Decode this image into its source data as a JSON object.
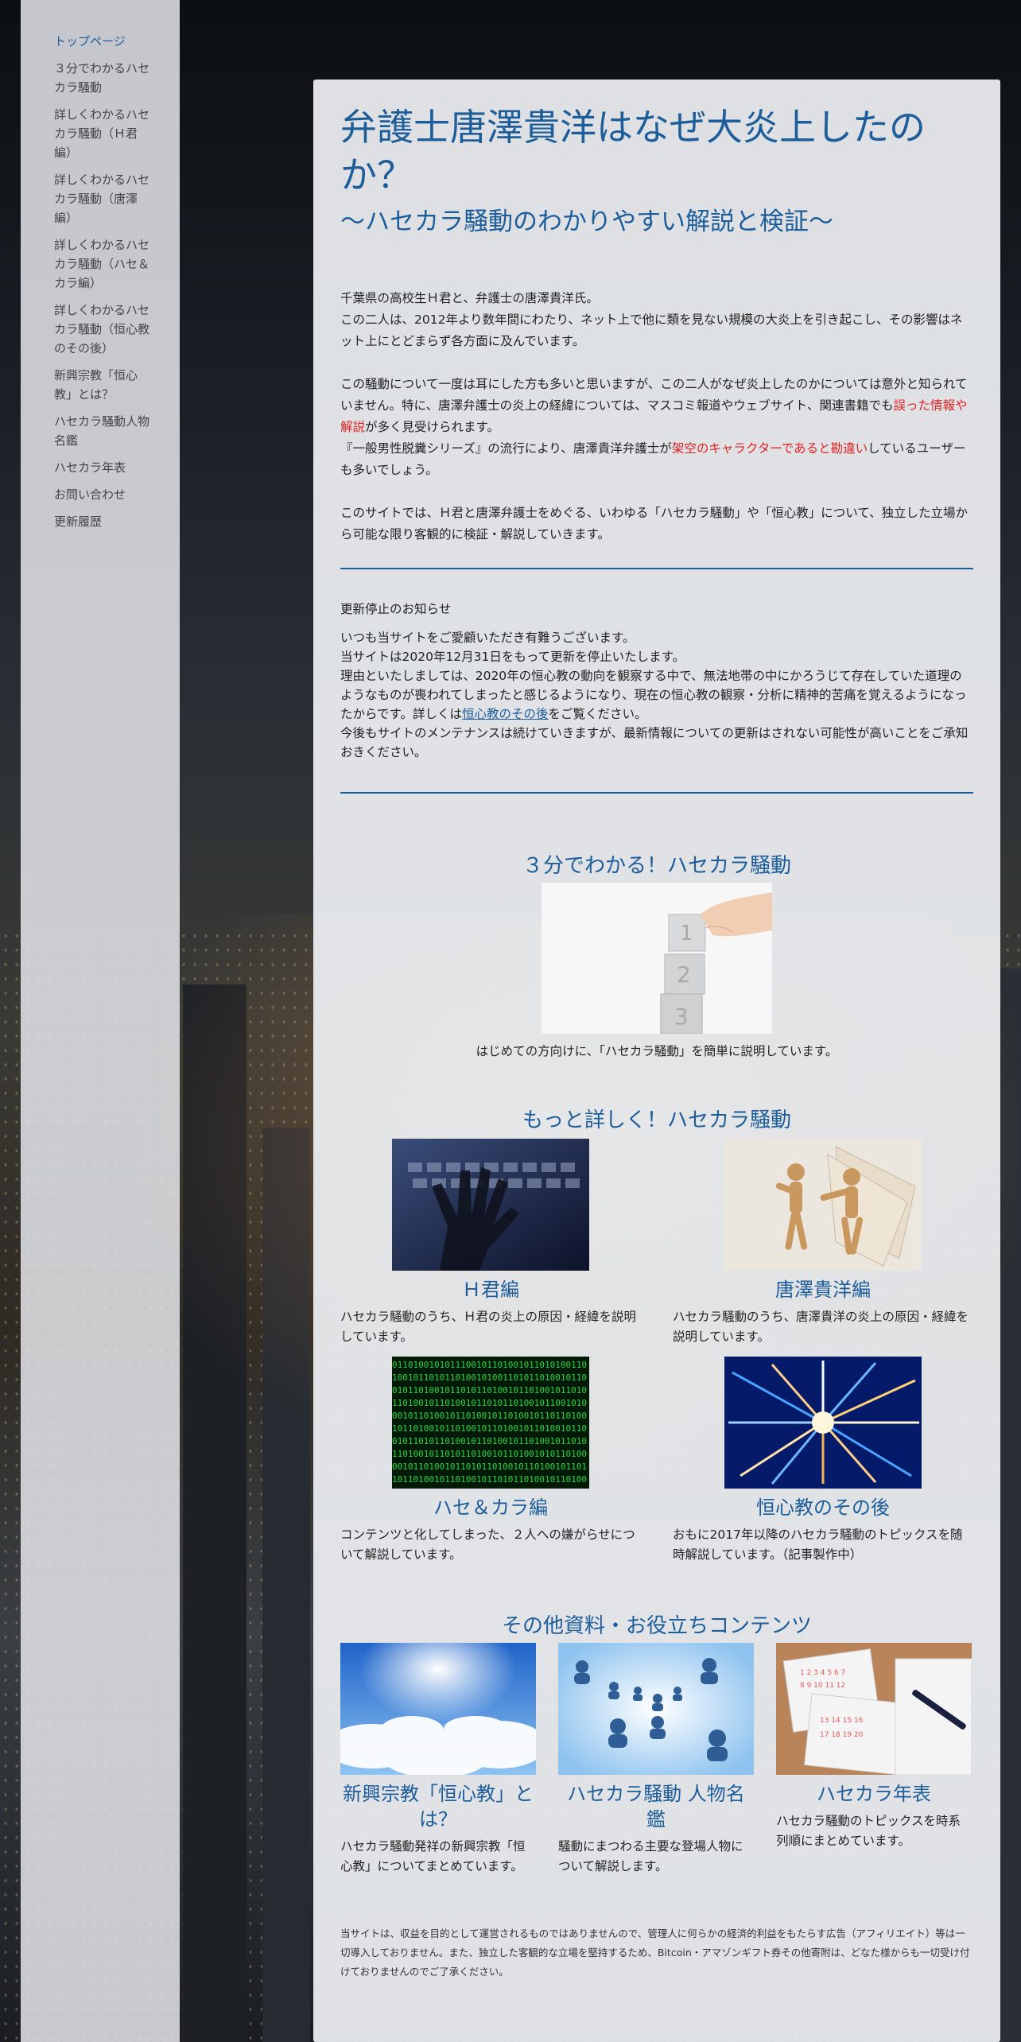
{
  "sidebar": {
    "items": [
      {
        "label": "トップページ"
      },
      {
        "label": "３分でわかるハセカラ騒動"
      },
      {
        "label": "詳しくわかるハセカラ騒動（Ｈ君編）"
      },
      {
        "label": "詳しくわかるハセカラ騒動（唐澤編）"
      },
      {
        "label": "詳しくわかるハセカラ騒動（ハセ＆カラ編）"
      },
      {
        "label": "詳しくわかるハセカラ騒動（恒心教のその後）"
      },
      {
        "label": "新興宗教「恒心教」とは？"
      },
      {
        "label": "ハセカラ騒動人物名鑑"
      },
      {
        "label": "ハセカラ年表"
      },
      {
        "label": "お問い合わせ"
      },
      {
        "label": "更新履歴"
      }
    ]
  },
  "main": {
    "title": "弁護士唐澤貴洋はなぜ大炎上したのか？",
    "subtitle": "～ハセカラ騒動のわかりやすい解説と検証～",
    "intro": {
      "p1_line1": "千葉県の高校生Ｈ君と、弁護士の唐澤貴洋氏。",
      "p1_line2": "この二人は、2012年より数年間にわたり、ネット上で他に類を見ない規模の大炎上を引き起こし、その影響はネット上にとどまらず各方面に及んでいます。",
      "p2_a": "この騒動について一度は耳にした方も多いと思いますが、この二人がなぜ炎上したのかについては意外と知られていません。特に、唐澤弁護士の炎上の経緯については、マスコミ報道やウェブサイト、関連書籍でも",
      "p2_red1": "誤った情報や解説",
      "p2_b": "が多く見受けられます。",
      "p2_c": "『一般男性脱糞シリーズ』の流行により、唐澤貴洋弁護士が",
      "p2_red2": "架空のキャラクターであると勘違い",
      "p2_d": "しているユーザーも多いでしょう。",
      "p3": "このサイトでは、Ｈ君と唐澤弁護士をめぐる、いわゆる「ハセカラ騒動」や「恒心教」について、独立した立場から可能な限り客観的に検証・解説していきます。"
    },
    "notice": {
      "title": "更新停止のお知らせ",
      "l1": "いつも当サイトをご愛顧いただき有難うございます。",
      "l2": "当サイトは2020年12月31日をもって更新を停止いたします。",
      "l3": "理由といたしましては、2020年の恒心教の動向を観察する中で、無法地帯の中にかろうじて存在していた道理のようなものが喪われてしまったと感じるようになり、現在の恒心教の観察・分析に精神的苦痛を覚えるようになったからです。詳しくは",
      "l3_link": "恒心教のその後",
      "l3_end": "をご覧ください。",
      "l4": "今後もサイトのメンテナンスは続けていきますが、最新情報についての更新はされない可能性が高いことをご承知おきください。"
    },
    "section1": {
      "heading": "３分でわかる！ハセカラ騒動",
      "caption": "はじめての方向けに、「ハセカラ騒動」を簡単に説明しています。"
    },
    "section2": {
      "heading": "もっと詳しく！ハセカラ騒動",
      "cards": [
        {
          "title": "Ｈ君編",
          "desc": "ハセカラ騒動のうち、Ｈ君の炎上の原因・経緯を説明しています。"
        },
        {
          "title": "唐澤貴洋編",
          "desc": "ハセカラ騒動のうち、唐澤貴洋の炎上の原因・経緯を説明しています。"
        },
        {
          "title": "ハセ＆カラ編",
          "desc": "コンテンツと化してしまった、２人への嫌がらせについて解説しています。"
        },
        {
          "title": "恒心教のその後",
          "desc": "おもに2017年以降のハセカラ騒動のトピックスを随時解説しています。（記事製作中）"
        }
      ]
    },
    "section3": {
      "heading": "その他資料・お役立ちコンテンツ",
      "cards": [
        {
          "title": "新興宗教「恒心教」とは？",
          "desc": "ハセカラ騒動発祥の新興宗教「恒心教」についてまとめています。"
        },
        {
          "title": "ハセカラ騒動 人物名鑑",
          "desc": "騒動にまつわる主要な登場人物について解説します。"
        },
        {
          "title": "ハセカラ年表",
          "desc": "ハセカラ騒動のトピックスを時系列順にまとめています。"
        }
      ]
    },
    "footer": {
      "note": "当サイトは、収益を目的として運営されるものではありませんので、管理人に何らかの経済的利益をもたらす広告（アフィリエイト）等は一切導入しておりません。また、独立した客観的な立場を堅持するため、Bitcoin・アマゾンギフト券その他寄附は、どなた様からも一切受け付けておりませんのでご了承ください。"
    }
  },
  "colors": {
    "accent": "#1c5d9a",
    "emphasis": "#e02020"
  }
}
